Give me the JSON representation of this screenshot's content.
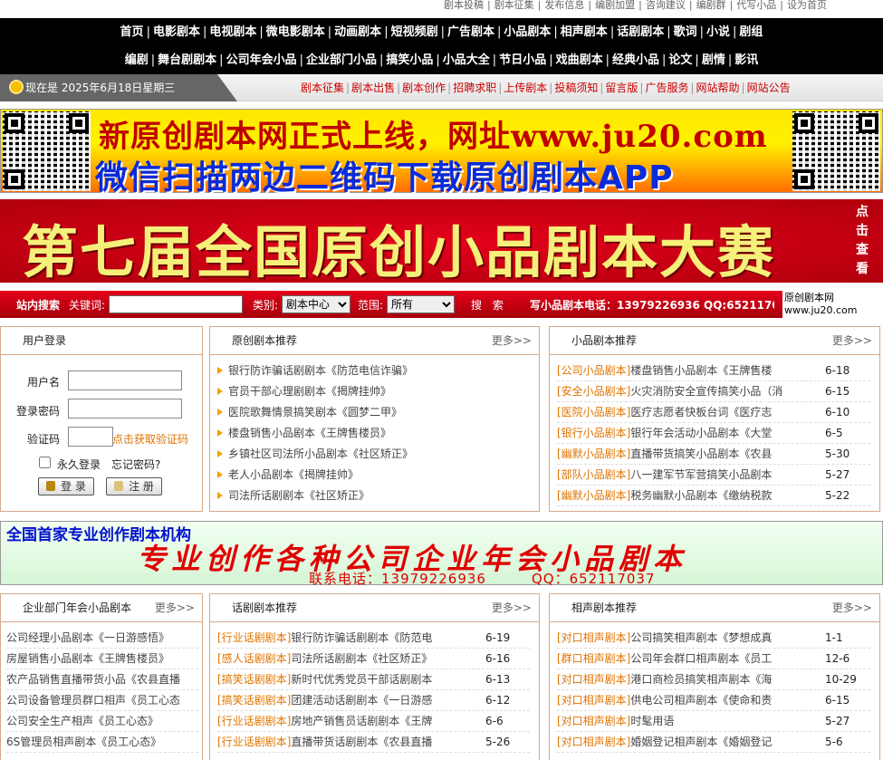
{
  "top_links": [
    "剧本投稿",
    "剧本征集",
    "发布信息",
    "编剧加盟",
    "咨询建议",
    "编剧群",
    "代写小品",
    "设为首页"
  ],
  "nav": {
    "row1": [
      "首页",
      "电影剧本",
      "电视剧本",
      "微电影剧本",
      "动画剧本",
      "短视频剧",
      "广告剧本",
      "小品剧本",
      "相声剧本",
      "话剧剧本",
      "歌词",
      "小说",
      "剧组"
    ],
    "row2": [
      "编剧",
      "舞台剧剧本",
      "公司年会小品",
      "企业部门小品",
      "搞笑小品",
      "小品大全",
      "节日小品",
      "戏曲剧本",
      "经典小品",
      "论文",
      "剧情",
      "影讯"
    ]
  },
  "date_text": "现在是 2025年6月18日星期三",
  "sub_links": [
    "剧本征集",
    "剧本出售",
    "剧本创作",
    "招聘求职",
    "上传剧本",
    "投稿须知",
    "留言版",
    "广告服务",
    "网站帮助",
    "网站公告"
  ],
  "banner1": {
    "line1": "新原创剧本网正式上线，网址www.ju20.com",
    "line2": "微信扫描两边二维码下载原创剧本APP"
  },
  "banner2": {
    "text": "第七届全国原创小品剧本大赛",
    "side": "点击查看"
  },
  "search": {
    "site_search": "站内搜索",
    "keyword_label": "关键词:",
    "category_label": "类别:",
    "category_value": "剧本中心",
    "range_label": "范围:",
    "range_value": "所有",
    "button": "搜 索",
    "phone": "写小品剧本电话：13979226936 QQ:652117037",
    "logo_line1": "原创剧本网",
    "logo_line2": "www.ju20.com"
  },
  "login": {
    "title": "用户登录",
    "username_label": "用户名",
    "password_label": "登录密码",
    "captcha_label": "验证码",
    "captcha_link": "点击获取验证码",
    "remember": "永久登录",
    "forgot": "忘记密码?",
    "login_btn": "登 录",
    "register_btn": "注 册"
  },
  "more": "更多>>",
  "original": {
    "title": "原创剧本推荐",
    "items": [
      "银行防诈骗话剧剧本《防范电信诈骗》",
      "官员干部心理剧剧本《揭牌挂帅》",
      "医院歌舞情景搞笑剧本《圆梦二甲》",
      "楼盘销售小品剧本《王牌售楼员》",
      "乡镇社区司法所小品剧本《社区矫正》",
      "老人小品剧本《揭牌挂帅》",
      "司法所话剧剧本《社区矫正》"
    ]
  },
  "xiaopin": {
    "title": "小品剧本推荐",
    "items": [
      {
        "tag": "[公司小品剧本]",
        "text": "楼盘销售小品剧本《王牌售楼",
        "date": "6-18"
      },
      {
        "tag": "[安全小品剧本]",
        "text": "火灾消防安全宣传搞笑小品（消",
        "date": "6-15"
      },
      {
        "tag": "[医院小品剧本]",
        "text": "医疗志愿者快板台词《医疗志",
        "date": "6-10"
      },
      {
        "tag": "[银行小品剧本]",
        "text": "银行年会活动小品剧本《大堂",
        "date": "6-5"
      },
      {
        "tag": "[幽默小品剧本]",
        "text": "直播带货搞笑小品剧本《农县",
        "date": "5-30"
      },
      {
        "tag": "[部队小品剧本]",
        "text": "八一建军节军营搞笑小品剧本",
        "date": "5-27"
      },
      {
        "tag": "[幽默小品剧本]",
        "text": "税务幽默小品剧本《缴纳税款",
        "date": "5-22"
      }
    ]
  },
  "banner3": {
    "line1": "全国首家专业创作剧本机构",
    "line2": "专业创作各种公司企业年会小品剧本",
    "phone": "联系电话：13979226936",
    "qq": "QQ：652117037"
  },
  "enterprise": {
    "title": "企业部门年会小品剧本",
    "items": [
      "公司经理小品剧本《一日游感悟》",
      "房屋销售小品剧本《王牌售楼员》",
      "农产品销售直播带货小品《农县直播",
      "公司设备管理员群口相声《员工心态",
      "公司安全生产相声《员工心态》",
      "6S管理员相声剧本《员工心态》"
    ]
  },
  "huaju": {
    "title": "话剧剧本推荐",
    "items": [
      {
        "tag": "[行业话剧剧本]",
        "text": "银行防诈骗话剧剧本《防范电",
        "date": "6-19"
      },
      {
        "tag": "[感人话剧剧本]",
        "text": "司法所话剧剧本《社区矫正》",
        "date": "6-16"
      },
      {
        "tag": "[搞笑话剧剧本]",
        "text": "新时代优秀党员干部话剧剧本",
        "date": "6-13"
      },
      {
        "tag": "[搞笑话剧剧本]",
        "text": "团建活动话剧剧本《一日游感",
        "date": "6-12"
      },
      {
        "tag": "[行业话剧剧本]",
        "text": "房地产销售员话剧剧本《王牌",
        "date": "6-6"
      },
      {
        "tag": "[行业话剧剧本]",
        "text": "直播带货话剧剧本《农县直播",
        "date": "5-26"
      }
    ]
  },
  "xiangsheng": {
    "title": "相声剧本推荐",
    "items": [
      {
        "tag": "[对口相声剧本]",
        "text": "公司搞笑相声剧本《梦想成真",
        "date": "1-1"
      },
      {
        "tag": "[群口相声剧本]",
        "text": "公司年会群口相声剧本《员工",
        "date": "12-6"
      },
      {
        "tag": "[对口相声剧本]",
        "text": "港口商检员搞笑相声剧本《海",
        "date": "10-29"
      },
      {
        "tag": "[对口相声剧本]",
        "text": "供电公司相声剧本《使命和责",
        "date": "6-15"
      },
      {
        "tag": "[对口相声剧本]",
        "text": "时髦用语",
        "date": "5-27"
      },
      {
        "tag": "[对口相声剧本]",
        "text": "婚姻登记相声剧本《婚姻登记",
        "date": "5-6"
      }
    ]
  }
}
